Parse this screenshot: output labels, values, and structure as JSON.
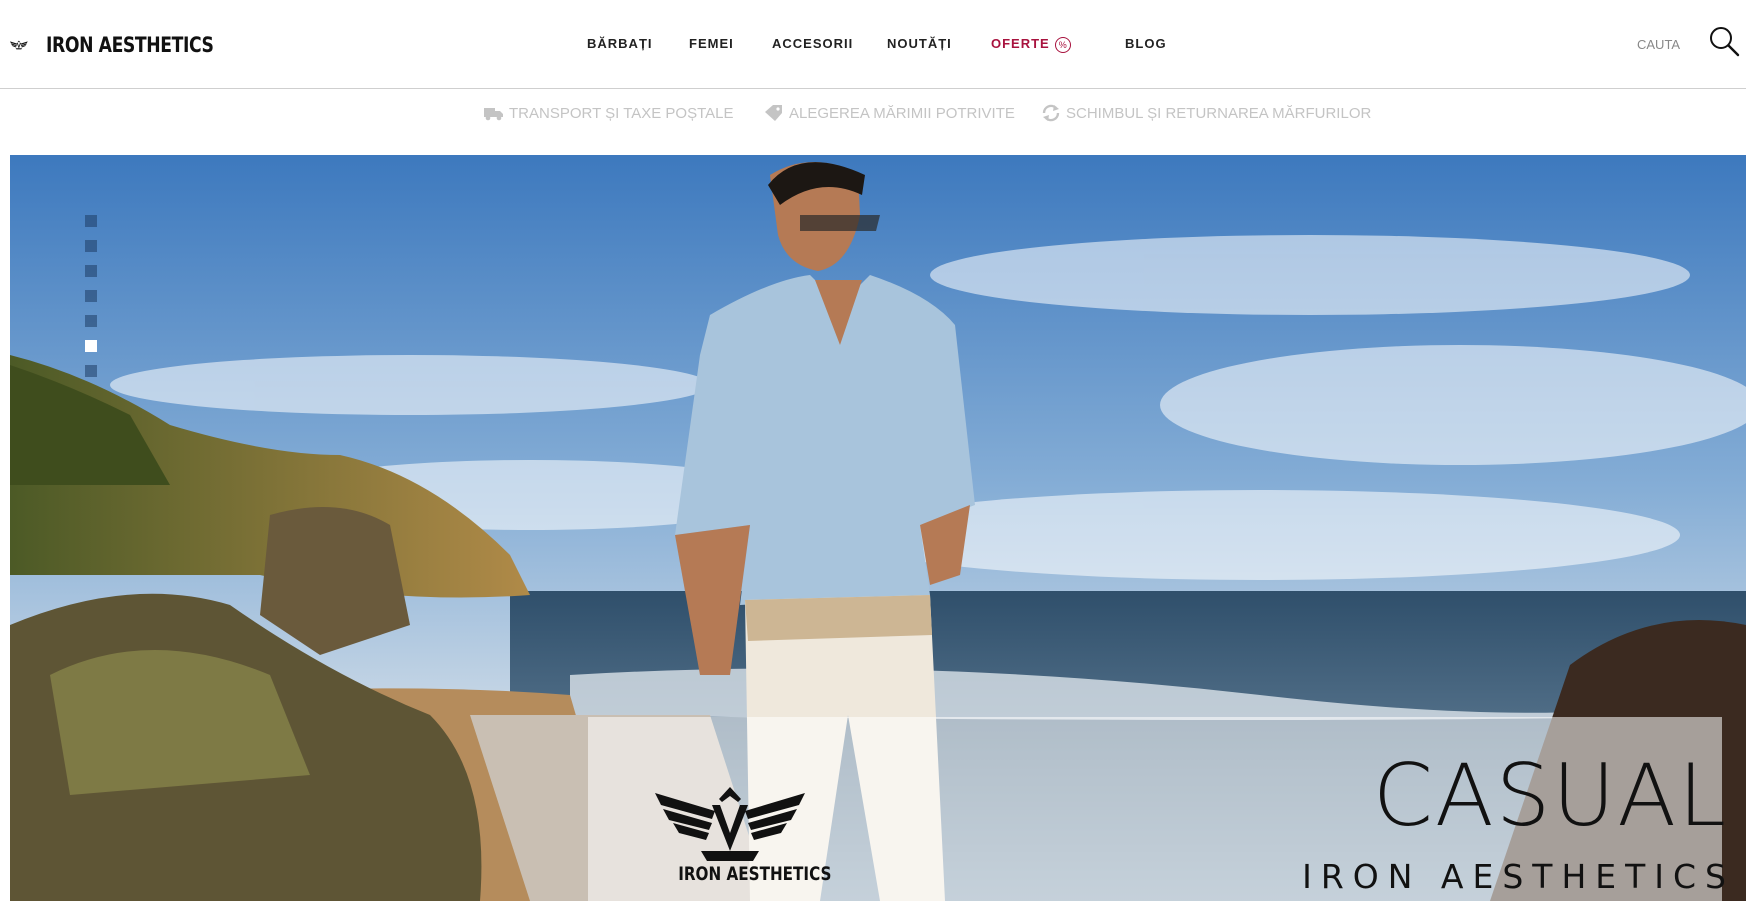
{
  "brand": {
    "name": "IRON AESTHETICS"
  },
  "nav": {
    "items": [
      {
        "label": "BĂRBAȚI"
      },
      {
        "label": "FEMEI"
      },
      {
        "label": "ACCESORII"
      },
      {
        "label": "NOUTĂȚI"
      },
      {
        "label": "OFERTE",
        "badge": "%",
        "accent": "#a8123e"
      },
      {
        "label": "BLOG"
      }
    ]
  },
  "search": {
    "label": "CAUTA",
    "icon": "search-icon"
  },
  "infobar": {
    "items": [
      {
        "label": "TRANSPORT ȘI TAXE POȘTALE",
        "icon": "truck-icon"
      },
      {
        "label": "ALEGEREA MĂRIMII POTRIVITE",
        "icon": "size-tag-icon"
      },
      {
        "label": "SCHIMBUL ȘI RETURNAREA MĂRFURILOR",
        "icon": "refresh-icon"
      }
    ]
  },
  "hero": {
    "slides_count": 7,
    "active_slide": 6,
    "overlay": {
      "logo_text": "IRON AESTHETICS",
      "title": "CASUAL",
      "subtitle": "IRON AESTHETICS"
    }
  },
  "colors": {
    "accent": "#a8123e",
    "text": "#222222",
    "muted": "#c4c4c4"
  }
}
